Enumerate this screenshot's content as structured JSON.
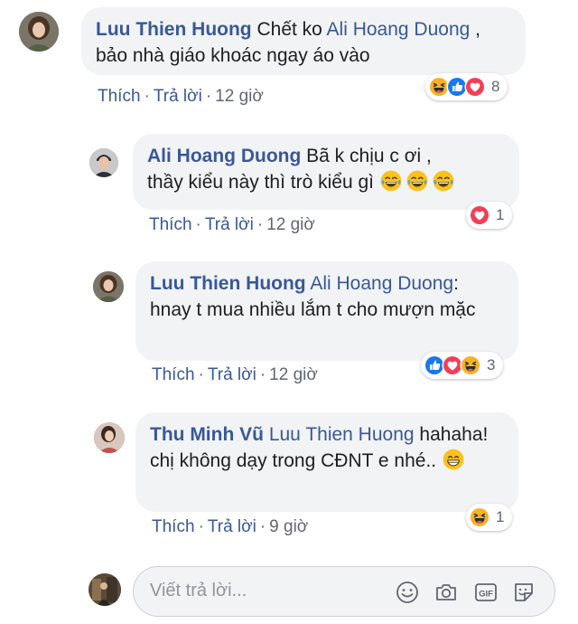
{
  "comments": [
    {
      "author": "Luu Thien Huong",
      "text_parts": [
        "Chết ko ",
        "Ali Hoang Duong",
        " , bảo nhà giáo khoác ngay áo vào"
      ],
      "actions": {
        "like": "Thích",
        "reply": "Trả lời",
        "time": "12 giờ"
      },
      "reaction_count": "8",
      "reactions": [
        "haha",
        "like",
        "love"
      ]
    },
    {
      "author": "Ali Hoang Duong",
      "text_parts": [
        "Bã k chịu c ơi ,",
        "thầy kiểu này thì trò kiểu gì"
      ],
      "actions": {
        "like": "Thích",
        "reply": "Trả lời",
        "time": "12 giờ"
      },
      "reaction_count": "1",
      "reactions": [
        "love"
      ],
      "trailing_emoji": [
        "tears-of-joy",
        "tears-of-joy",
        "tears-of-joy"
      ]
    },
    {
      "author": "Luu Thien Huong",
      "text_parts": [
        "Ali Hoang Duong",
        ":",
        "hnay t mua nhiều lắm t cho mượn mặc"
      ],
      "actions": {
        "like": "Thích",
        "reply": "Trả lời",
        "time": "12 giờ"
      },
      "reaction_count": "3",
      "reactions": [
        "like",
        "love",
        "haha"
      ]
    },
    {
      "author": "Thu Minh Vũ",
      "text_parts": [
        "Luu Thien Huong",
        "hahaha! chị không dạy trong CĐNT e nhé.."
      ],
      "actions": {
        "like": "Thích",
        "reply": "Trả lời",
        "time": "9 giờ"
      },
      "reaction_count": "1",
      "reactions": [
        "haha"
      ],
      "trailing_emoji": [
        "grinning"
      ]
    }
  ],
  "reply_box": {
    "placeholder": "Viết trả lời...",
    "tools": [
      "emoji-icon",
      "camera-icon",
      "gif-icon",
      "sticker-icon"
    ]
  },
  "colors": {
    "link": "#385898",
    "bubble": "#f2f3f5",
    "meta": "#606770",
    "like": "#1877f2",
    "love": "#f33e58",
    "haha": "#f7b125"
  }
}
